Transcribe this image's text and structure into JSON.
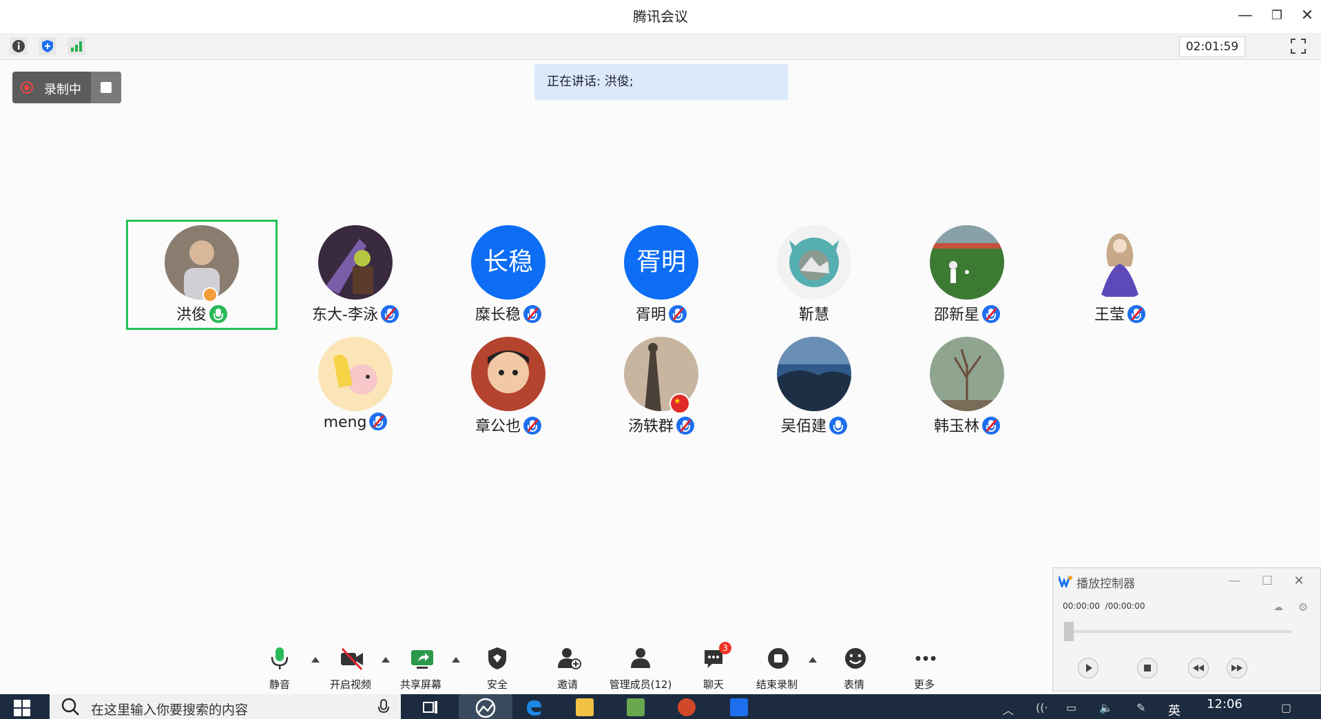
{
  "window": {
    "title": "腾讯会议",
    "minimize": "—",
    "restore": "❐",
    "close": "✕"
  },
  "meeting": {
    "elapsed": "02:01:59"
  },
  "recording": {
    "label": "录制中"
  },
  "speaking": {
    "text": "正在讲话: 洪俊;"
  },
  "participants": [
    {
      "name": "洪俊",
      "avatar_text": "",
      "mic": "on",
      "host": true
    },
    {
      "name": "东大-李泳",
      "avatar_text": "",
      "mic": "muted"
    },
    {
      "name": "糜长稳",
      "avatar_text": "长稳",
      "mic": "muted"
    },
    {
      "name": "胥明",
      "avatar_text": "胥明",
      "mic": "muted"
    },
    {
      "name": "靳慧",
      "avatar_text": "",
      "mic": "none"
    },
    {
      "name": "邵新星",
      "avatar_text": "",
      "mic": "muted"
    },
    {
      "name": "王莹",
      "avatar_text": "",
      "mic": "muted"
    },
    {
      "name": "meng",
      "avatar_text": "",
      "mic": "muted"
    },
    {
      "name": "章公也",
      "avatar_text": "",
      "mic": "muted"
    },
    {
      "name": "汤轶群",
      "avatar_text": "",
      "mic": "muted"
    },
    {
      "name": "吴佰建",
      "avatar_text": "",
      "mic": "available"
    },
    {
      "name": "韩玉林",
      "avatar_text": "",
      "mic": "muted"
    }
  ],
  "bottombar": {
    "mute": "静音",
    "video": "开启视频",
    "share": "共享屏幕",
    "security": "安全",
    "invite": "邀请",
    "members": "管理成员(12)",
    "chat": "聊天",
    "chat_badge": "3",
    "end_record": "结束录制",
    "emoji": "表情",
    "more": "更多"
  },
  "player": {
    "title": "播放控制器",
    "current": "00:00:00",
    "total": "/00:00:00",
    "progress": 0
  },
  "taskbar": {
    "search_placeholder": "在这里输入你要搜索的内容",
    "ime": "英",
    "clock": "12:06"
  },
  "colors": {
    "accent": "#0d6df5",
    "active_border": "#22c158",
    "speaking_bg": "#dbe9fb",
    "muted_slash": "#e3242b"
  }
}
